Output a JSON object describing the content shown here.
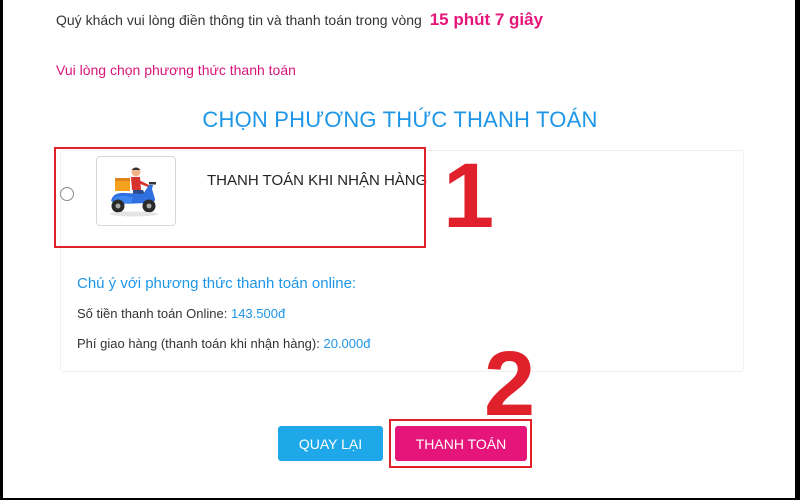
{
  "header": {
    "timer_text": "Quý khách vui lòng điền thông tin và thanh toán trong vòng",
    "timer_value": "15 phút 7 giây",
    "notice": "Vui lòng chọn phương thức thanh toán"
  },
  "payment": {
    "section_title": "CHỌN PHƯƠNG THỨC THANH TOÁN",
    "methods": [
      {
        "label": "THANH TOÁN KHI NHẬN HÀNG",
        "icon": "delivery-scooter-icon",
        "selected": false
      }
    ]
  },
  "online_note": {
    "title": "Chú ý với phương thức thanh toán online:",
    "amount_label": "Số tiền thanh toán Online:",
    "amount_value": "143.500đ",
    "shipping_label": "Phí giao hàng (thanh toán khi nhận hàng):",
    "shipping_value": "20.000đ"
  },
  "actions": {
    "back_label": "QUAY LẠI",
    "pay_label": "THANH TOÁN"
  },
  "annotations": {
    "step_1": "1",
    "step_2": "2"
  },
  "colors": {
    "accent_pink": "#e6157a",
    "accent_blue": "#1e96e8",
    "highlight_red": "#e0202a"
  }
}
